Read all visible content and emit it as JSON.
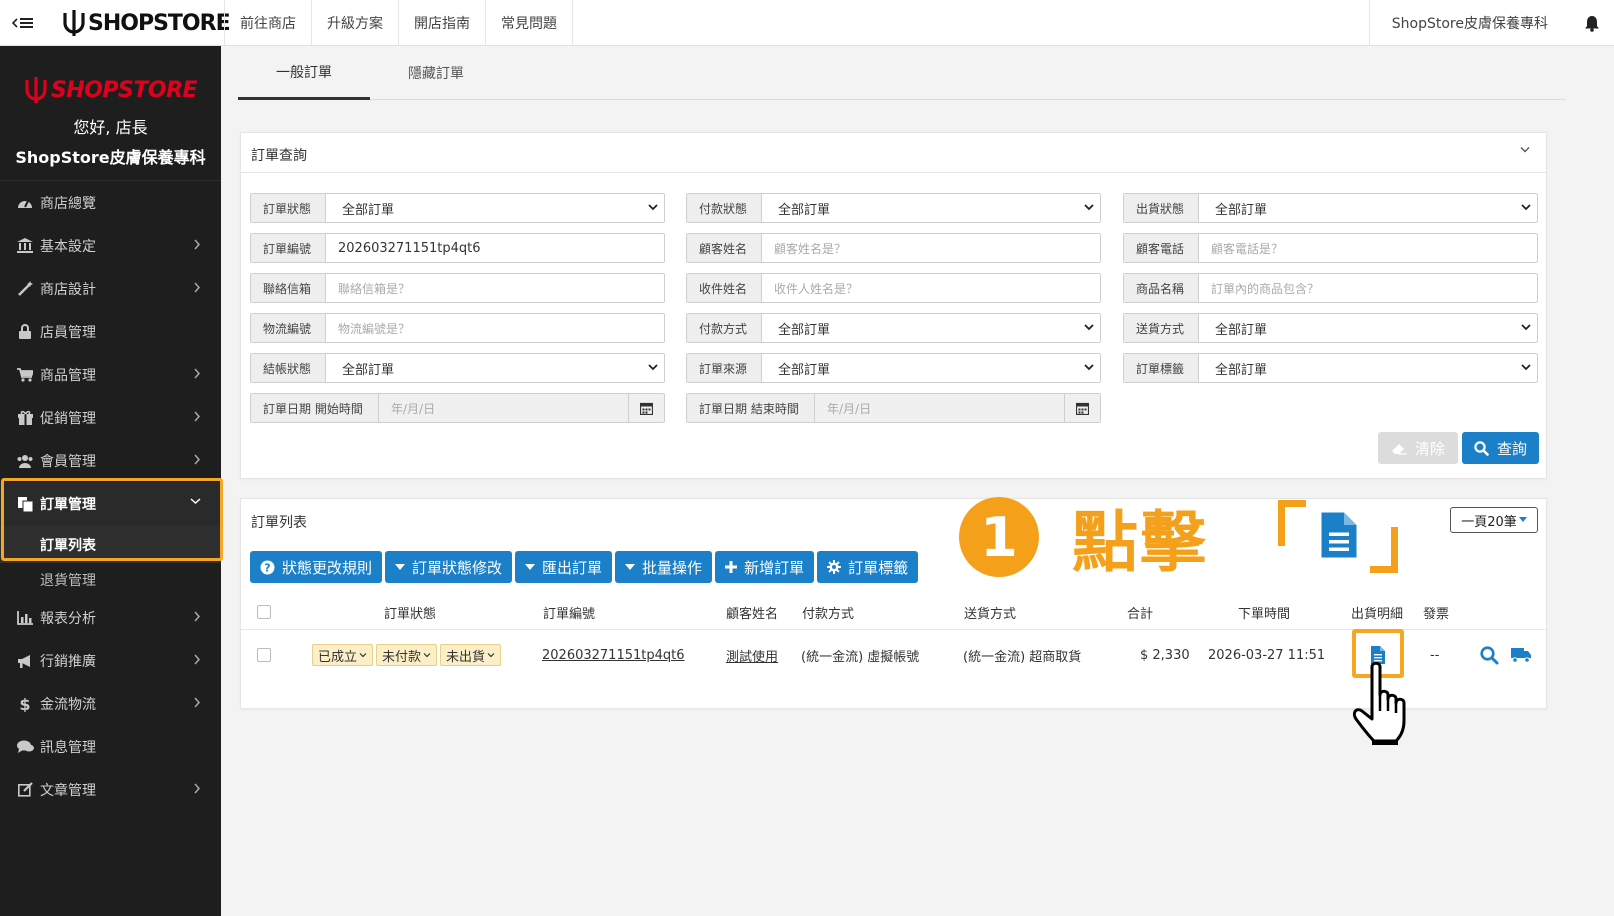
{
  "topbar": {
    "logo_text": "SHOPSTORE",
    "nav": [
      "前往商店",
      "升級方案",
      "開店指南",
      "常見問題"
    ],
    "store_name": "ShopStore皮膚保養專科"
  },
  "sidebar": {
    "logo_text": "SHOPSTORE",
    "greeting": "您好, 店長",
    "store_name": "ShopStore皮膚保養專科",
    "items": [
      {
        "label": "商店總覽",
        "icon": "dashboard-icon"
      },
      {
        "label": "基本設定",
        "icon": "bank-icon"
      },
      {
        "label": "商店設計",
        "icon": "magic-wand-icon"
      },
      {
        "label": "店員管理",
        "icon": "lock-icon"
      },
      {
        "label": "商品管理",
        "icon": "cart-icon"
      },
      {
        "label": "促銷管理",
        "icon": "gift-icon"
      },
      {
        "label": "會員管理",
        "icon": "users-icon"
      },
      {
        "label": "訂單管理",
        "icon": "copy-icon"
      },
      {
        "label": "報表分析",
        "icon": "bar-chart-icon"
      },
      {
        "label": "行銷推廣",
        "icon": "bullhorn-icon"
      },
      {
        "label": "金流物流",
        "icon": "dollar-icon"
      },
      {
        "label": "訊息管理",
        "icon": "comments-icon"
      },
      {
        "label": "文章管理",
        "icon": "edit-icon"
      }
    ],
    "orders_sub": [
      "訂單列表",
      "退貨管理"
    ]
  },
  "tabs": [
    "一般訂單",
    "隱藏訂單"
  ],
  "query": {
    "title": "訂單查詢",
    "fields": [
      {
        "label": "訂單狀態",
        "value": "全部訂單"
      },
      {
        "label": "付款狀態",
        "value": "全部訂單"
      },
      {
        "label": "出貨狀態",
        "value": "全部訂單"
      },
      {
        "label": "訂單編號",
        "value": "202603271151tp4qt6"
      },
      {
        "label": "顧客姓名",
        "placeholder": "顧客姓名是？"
      },
      {
        "label": "顧客電話",
        "placeholder": "顧客電話是？"
      },
      {
        "label": "聯絡信箱",
        "placeholder": "聯絡信箱是？"
      },
      {
        "label": "收件姓名",
        "placeholder": "收件人姓名是？"
      },
      {
        "label": "商品名稱",
        "placeholder": "訂單內的商品包含？"
      },
      {
        "label": "物流編號",
        "placeholder": "物流編號是？"
      },
      {
        "label": "付款方式",
        "value": "全部訂單"
      },
      {
        "label": "送貨方式",
        "value": "全部訂單"
      },
      {
        "label": "結帳狀態",
        "value": "全部訂單"
      },
      {
        "label": "訂單來源",
        "value": "全部訂單"
      },
      {
        "label": "訂單標籤",
        "value": "全部訂單"
      },
      {
        "label": "訂單日期 開始時間",
        "placeholder": "年/月/日"
      },
      {
        "label": "訂單日期 結束時間",
        "placeholder": "年/月/日"
      }
    ],
    "clear_label": "清除",
    "search_label": "查詢"
  },
  "list": {
    "title": "訂單列表",
    "per_page": "一頁20筆",
    "toolbar": [
      "狀態更改規則",
      "訂單狀態修改",
      "匯出訂單",
      "批量操作",
      "新增訂單",
      "訂單標籤"
    ],
    "headers": [
      "訂單狀態",
      "訂單編號",
      "顧客姓名",
      "付款方式",
      "送貨方式",
      "合計",
      "下單時間",
      "出貨明細",
      "發票"
    ],
    "rows": [
      {
        "order_status": "已成立",
        "payment_status": "未付款",
        "shipping_status": "未出貨",
        "order_no": "202603271151tp4qt6",
        "customer": "測試使用",
        "payment": "(統一金流) 虛擬帳號",
        "shipping": "(統一金流) 超商取貨",
        "total": "$ 2,330",
        "time": "2026-03-27 11:51",
        "invoice": "--"
      }
    ]
  },
  "annotation": {
    "number": "1",
    "text": "點擊"
  },
  "colors": {
    "primary": "#1c80c8",
    "highlight": "#f5a623",
    "brand_red": "#e0001b",
    "sidebar_bg": "#1e1e1e"
  }
}
